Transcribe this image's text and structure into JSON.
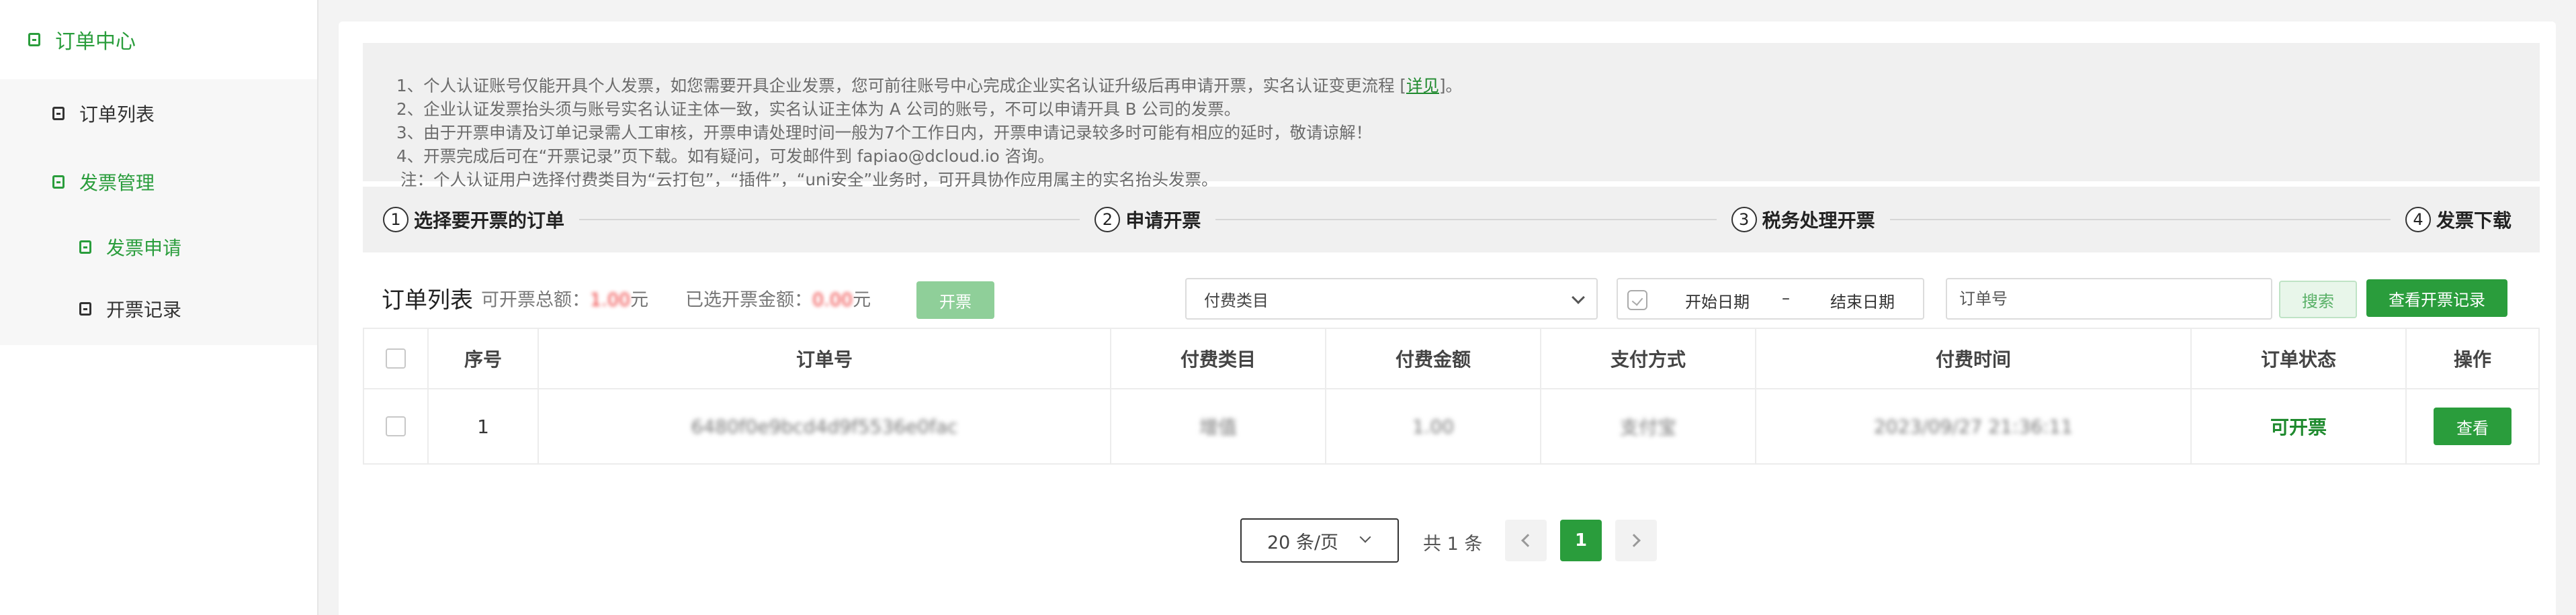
{
  "sidebar": {
    "group": "订单中心",
    "items": [
      {
        "label": "订单列表"
      },
      {
        "label": "发票管理"
      },
      {
        "label": "发票申请"
      },
      {
        "label": "开票记录"
      }
    ]
  },
  "notice": {
    "line1_pre": "1、个人认证账号仅能开具个人发票，如您需要开具企业发票，您可前往账号中心完成企业实名认证升级后再申请开票，实名认证变更流程 [",
    "line1_link": "详见",
    "line1_post": "]。",
    "line2": "2、企业认证发票抬头须与账号实名认证主体一致，实名认证主体为 A 公司的账号，不可以申请开具 B 公司的发票。",
    "line3": "3、由于开票申请及订单记录需人工审核，开票申请处理时间一般为7个工作日内，开票申请记录较多时可能有相应的延时，敬请谅解！",
    "line4": "4、开票完成后可在“开票记录”页下载。如有疑问，可发邮件到 fapiao@dcloud.io 咨询。",
    "line5": "注：个人认证用户选择付费类目为“云打包”，“插件”，“uni安全”业务时，可开具协作应用属主的实名抬头发票。"
  },
  "steps": [
    {
      "num": "1",
      "label": "选择要开票的订单"
    },
    {
      "num": "2",
      "label": "申请开票"
    },
    {
      "num": "3",
      "label": "税务处理开票"
    },
    {
      "num": "4",
      "label": "发票下载"
    }
  ],
  "toolbar": {
    "title": "订单列表",
    "total_label": "可开票总额：",
    "total_value": "1.00",
    "selected_label": "已选开票金额：",
    "selected_value": "0.00",
    "unit": "元",
    "issue_button": "开票",
    "category_placeholder": "付费类目",
    "date_start": "开始日期",
    "date_sep": "–",
    "date_end": "结束日期",
    "order_placeholder": "订单号",
    "search_button": "搜索",
    "records_button": "查看开票记录"
  },
  "table": {
    "headers": [
      "序号",
      "订单号",
      "付费类目",
      "付费金额",
      "支付方式",
      "付费时间",
      "订单状态",
      "操作"
    ],
    "rows": [
      {
        "index": "1",
        "order_no": "6480f0e9bcd4d9f5536e0fac",
        "category": "增值",
        "amount": "1.00",
        "payment": "支付宝",
        "time": "2023/09/27 21:36:11",
        "status": "可开票",
        "action": "查看"
      }
    ]
  },
  "pagination": {
    "page_size": "20 条/页",
    "total": "共 1 条",
    "current": "1"
  },
  "colors": {
    "brand": "#2a9d3c",
    "status_ok": "#1f8a2e"
  }
}
